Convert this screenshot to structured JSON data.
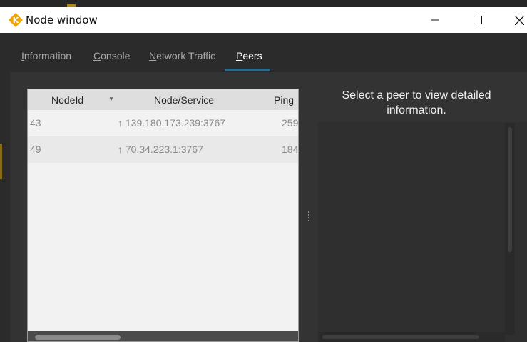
{
  "window": {
    "title": "Node window"
  },
  "tabs": [
    {
      "label": "Information",
      "accel": "I",
      "rest": "nformation"
    },
    {
      "label": "Console",
      "accel": "C",
      "rest": "onsole"
    },
    {
      "label": "Network Traffic",
      "accel": "N",
      "rest": "etwork Traffic"
    },
    {
      "label": "Peers",
      "accel": "P",
      "rest": "eers"
    }
  ],
  "active_tab": "Peers",
  "peer_table": {
    "columns": [
      "NodeId",
      "Node/Service",
      "Ping"
    ],
    "rows": [
      {
        "nodeid": "43",
        "service": "↑ 139.180.173.239:3767",
        "ping": "259"
      },
      {
        "nodeid": "49",
        "service": "↑ 70.34.223.1:3767",
        "ping": "184"
      }
    ]
  },
  "detail": {
    "message": "Select a peer to view detailed information."
  },
  "colors": {
    "active_tab_underline": "#2b6a8a",
    "app_icon": "#f0a500"
  },
  "icons": {
    "app": "app-logo-icon",
    "minimize": "minimize-icon",
    "maximize": "maximize-icon",
    "close": "close-icon",
    "sort": "sort-down-icon"
  }
}
